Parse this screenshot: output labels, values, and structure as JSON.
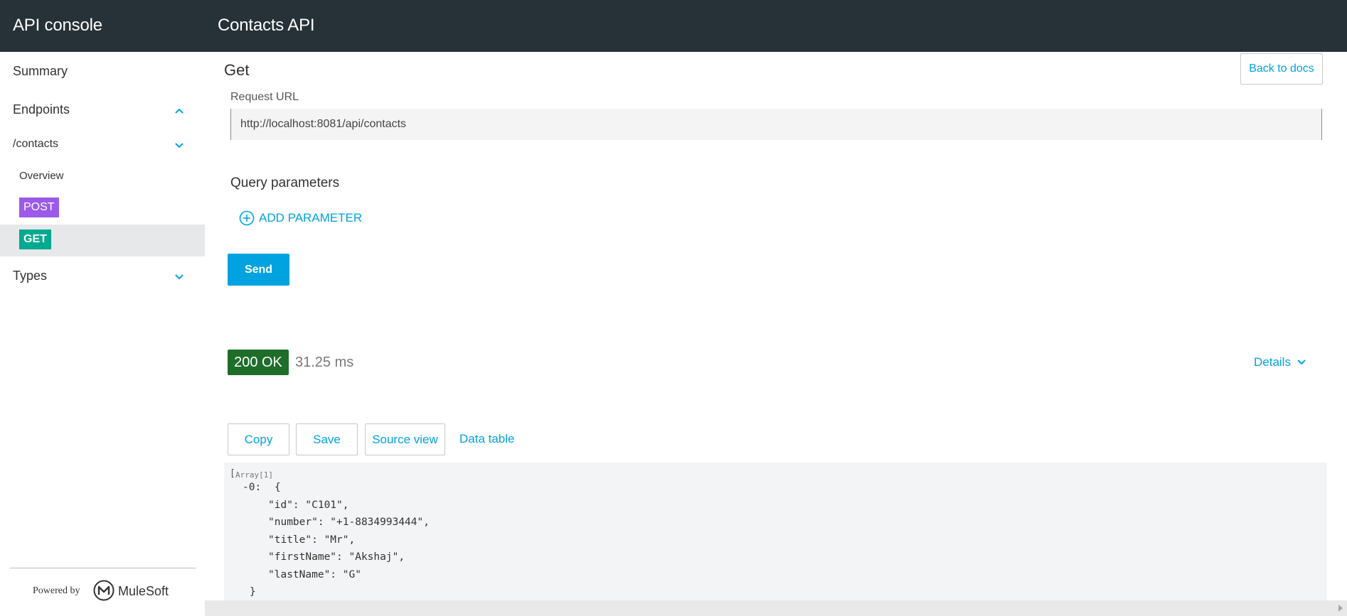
{
  "header": {
    "app_title": "API console",
    "api_title": "Contacts API"
  },
  "sidebar": {
    "summary": "Summary",
    "endpoints": "Endpoints",
    "contacts": "/contacts",
    "overview": "Overview",
    "post": "POST",
    "get": "GET",
    "types": "Types",
    "powered_by": "Powered by",
    "brand": "MuleSoft",
    "colors": {
      "post": "#9c5ae8",
      "get": "#00a98f"
    }
  },
  "main": {
    "method_title": "Get",
    "back_label": "Back to docs",
    "request_url_label": "Request URL",
    "request_url": "http://localhost:8081/api/contacts",
    "query_params_title": "Query parameters",
    "add_param_label": "ADD PARAMETER",
    "send_label": "Send",
    "status": "200 OK",
    "timing": "31.25 ms",
    "details_label": "Details",
    "actions": {
      "copy": "Copy",
      "save": "Save",
      "source_view": "Source view",
      "data_table": "Data table"
    },
    "json": {
      "array_label": "Array[1]",
      "open_bracket": "[",
      "index_prefix": "-0:",
      "open_brace": "{",
      "lines": [
        "\"id\": \"C101\",",
        "\"number\": \"+1-8834993444\",",
        "\"title\": \"Mr\",",
        "\"firstName\": \"Akshaj\",",
        "\"lastName\": \"G\""
      ],
      "close_brace": "}"
    }
  }
}
